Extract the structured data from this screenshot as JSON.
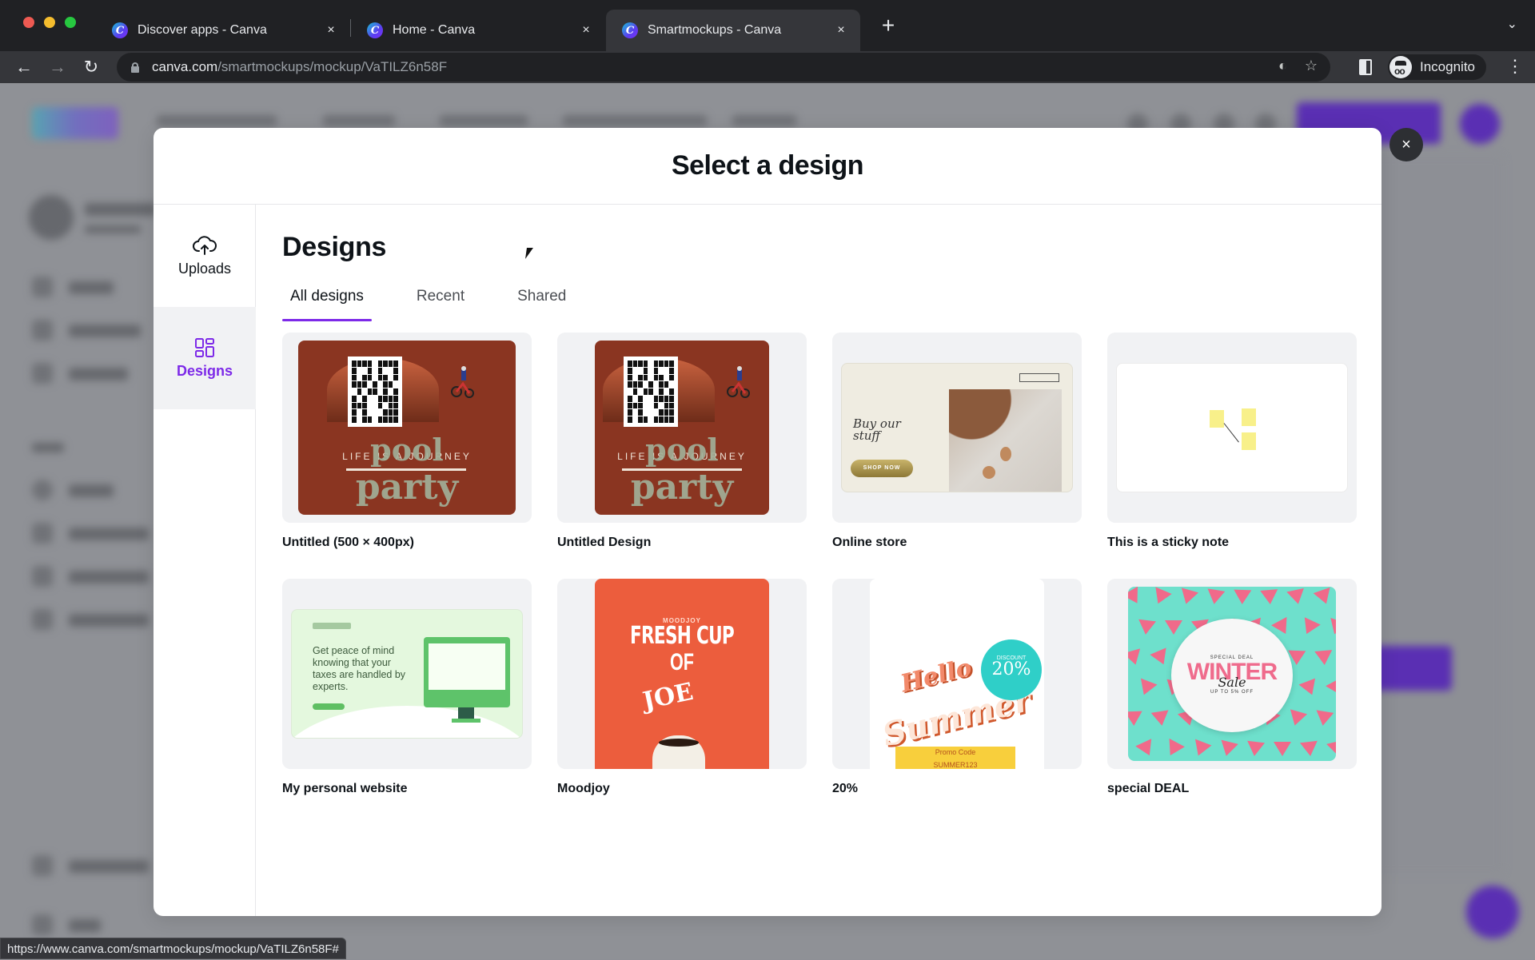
{
  "browser": {
    "tabs": [
      {
        "title": "Discover apps - Canva",
        "active": false
      },
      {
        "title": "Home - Canva",
        "active": false
      },
      {
        "title": "Smartmockups - Canva",
        "active": true
      }
    ],
    "new_tab_label": "+",
    "tab_close_glyph": "×",
    "tab_list_glyph": "⌄",
    "url_host": "canva.com",
    "url_path": "/smartmockups/mockup/VaTILZ6n58F",
    "profile_label": "Incognito",
    "icons": {
      "back": "arrow-left-icon",
      "forward": "arrow-right-icon",
      "reload": "reload-icon",
      "eye_off": "eye-slash-icon",
      "star": "star-icon",
      "side_panel": "side-panel-icon",
      "menu": "kebab-menu-icon"
    },
    "status_url": "https://www.canva.com/smartmockups/mockup/VaTILZ6n58F#"
  },
  "modal": {
    "title": "Select a design",
    "close_glyph": "×",
    "sidebar": [
      {
        "label": "Uploads",
        "icon": "cloud-upload-icon",
        "active": false
      },
      {
        "label": "Designs",
        "icon": "grid-icon",
        "active": true
      }
    ],
    "section_title": "Designs",
    "tabs": [
      {
        "label": "All designs",
        "active": true
      },
      {
        "label": "Recent",
        "active": false
      },
      {
        "label": "Shared",
        "active": false
      }
    ],
    "designs": [
      {
        "name": "Untitled (500 × 400px)",
        "thumb_text": [
          "LIFE IS A JOURNEY",
          "pool",
          "party"
        ]
      },
      {
        "name": "Untitled Design",
        "thumb_text": [
          "LIFE IS A JOURNEY",
          "pool",
          "party"
        ]
      },
      {
        "name": "Online store",
        "thumb_text": [
          "Buy our stuff",
          "SHOP NOW"
        ]
      },
      {
        "name": "This is a sticky note",
        "thumb_text": []
      },
      {
        "name": "My personal website",
        "thumb_text": [
          "Get peace of mind knowing that your taxes are handled by experts."
        ]
      },
      {
        "name": "Moodjoy",
        "thumb_text": [
          "MOODJOY",
          "FRESH CUP",
          "OF",
          "JOE"
        ]
      },
      {
        "name": "20%",
        "thumb_text": [
          "DISCOUNT",
          "20%",
          "Hello",
          "Summer",
          "Promo Code",
          "SUMMER123"
        ]
      },
      {
        "name": "special DEAL",
        "thumb_text": [
          "SPECIAL DEAL",
          "WINTER",
          "Sale",
          "UP TO 5% OFF"
        ]
      }
    ]
  },
  "colors": {
    "accent": "#7d2ae8",
    "modal_bg": "#ffffff",
    "overlay": "#8f9196",
    "chrome_dark": "#202124",
    "chrome_toolbar": "#35363a"
  }
}
